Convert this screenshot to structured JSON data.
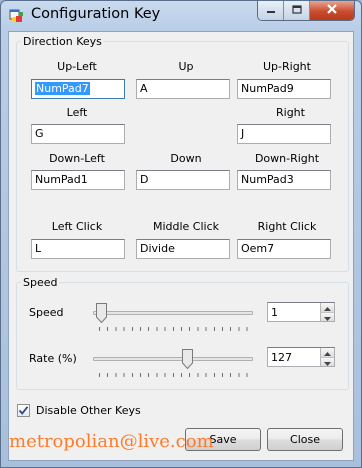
{
  "window": {
    "title": "Configuration Key"
  },
  "direction_keys": {
    "legend": "Direction Keys",
    "up_left": {
      "label": "Up-Left",
      "value": "NumPad7"
    },
    "up": {
      "label": "Up",
      "value": "A"
    },
    "up_right": {
      "label": "Up-Right",
      "value": "NumPad9"
    },
    "left": {
      "label": "Left",
      "value": "G"
    },
    "right": {
      "label": "Right",
      "value": "J"
    },
    "down_left": {
      "label": "Down-Left",
      "value": "NumPad1"
    },
    "down": {
      "label": "Down",
      "value": "D"
    },
    "down_right": {
      "label": "Down-Right",
      "value": "NumPad3"
    },
    "left_click": {
      "label": "Left Click",
      "value": "L"
    },
    "middle_click": {
      "label": "Middle Click",
      "value": "Divide"
    },
    "right_click": {
      "label": "Right Click",
      "value": "Oem7"
    }
  },
  "speed_group": {
    "legend": "Speed",
    "speed": {
      "label": "Speed",
      "value": "1",
      "level": 0.0
    },
    "rate": {
      "label": "Rate (%)",
      "value": "127",
      "level": 0.6
    }
  },
  "options": {
    "disable_other_keys": {
      "label": "Disable Other Keys",
      "checked": true
    }
  },
  "buttons": {
    "save": "Save",
    "close": "Close"
  },
  "watermark": "metropolian@live.com",
  "colors": {
    "selection": "#3399ff",
    "watermark": "#ff7b2b",
    "close_button": "#c94d2e"
  },
  "icons": {
    "app": "app-window-icon",
    "minimize": "minimize-icon",
    "maximize": "maximize-icon",
    "close": "close-icon"
  }
}
